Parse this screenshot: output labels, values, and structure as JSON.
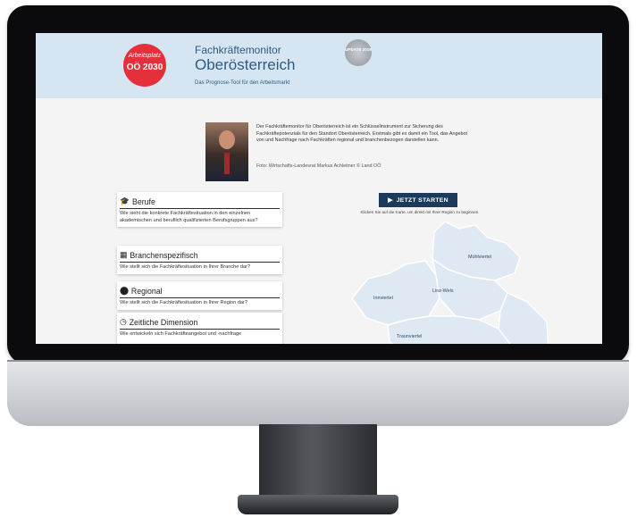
{
  "header": {
    "badge_line1": "Arbeitsplatz",
    "badge_line2": "OÖ 2030",
    "title_small": "Fachkräftemonitor",
    "title_big": "Oberösterreich",
    "subtitle": "Das Prognose-Tool für den Arbeitsmarkt",
    "update_badge": "UPDATE 2019"
  },
  "intro": {
    "text": "Der Fachkräftemonitor für Oberösterreich ist ein Schlüsselinstrument zur Sicherung des Fachkräftepotenzials für den Standort Oberösterreich. Erstmals gibt es damit ein Tool, das Angebot von und Nachfrage nach Fachkräften regional und branchenbezogen darstellen kann.",
    "credit": "Foto: Wirtschafts-Landesrat Markus Achleitner © Land OÖ"
  },
  "cards": [
    {
      "title": "Berufe",
      "icon": "graduation-cap-icon",
      "text": "Wie sieht die konkrete Fachkräftesituation in den einzelnen akademischen und beruflich qualifizierten Berufsgruppen aus?"
    },
    {
      "title": "Branchenspezifisch",
      "icon": "building-icon",
      "text": "Wie stellt sich die Fachkräftesituation in Ihrer Branche dar?"
    },
    {
      "title": "Regional",
      "icon": "map-marker-icon",
      "text": "Wie stellt sich die Fachkräftesituation in Ihrer Region dar?"
    },
    {
      "title": "Zeitliche Dimension",
      "icon": "clock-icon",
      "text": "Wie entwickeln sich Fachkräfteangebot und -nachfrage"
    }
  ],
  "start": {
    "label": "JETZT STARTEN",
    "hint": "Klicken Sie auf die Karte, um direkt mit Ihrer Region zu beginnen."
  },
  "map": {
    "regions": [
      "Mühlviertel",
      "Innviertel",
      "Linz-Wels",
      "Traunviertel"
    ]
  }
}
